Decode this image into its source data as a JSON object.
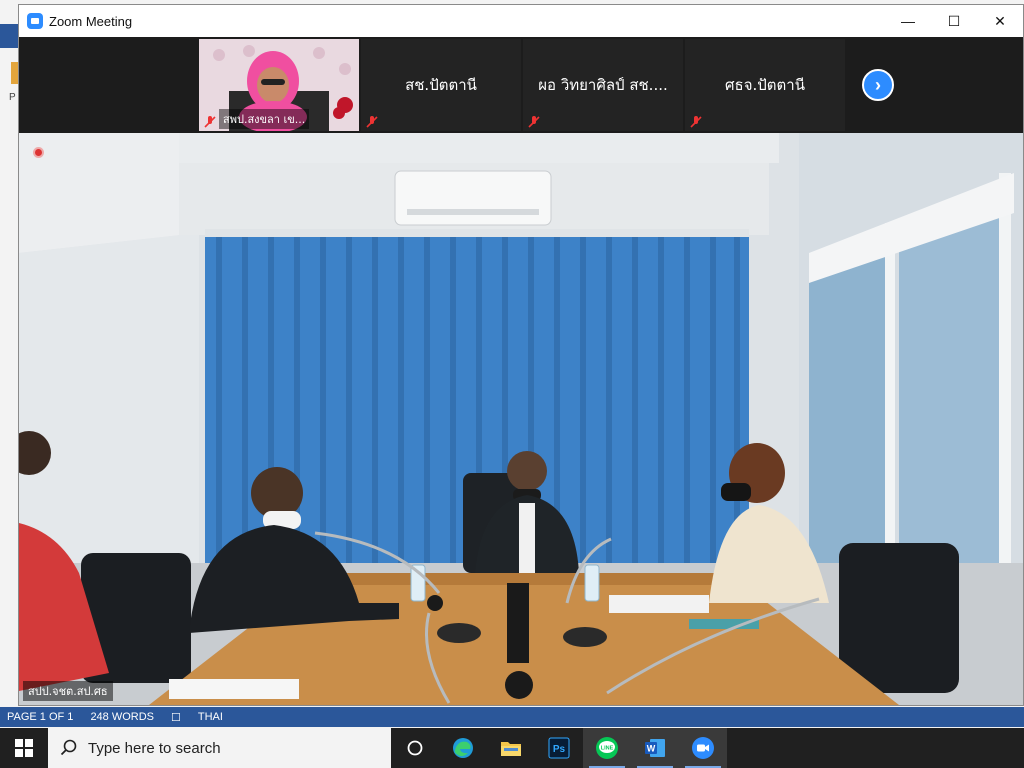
{
  "window": {
    "title": "Zoom Meeting"
  },
  "window_controls": {
    "minimize": "—",
    "maximize": "☐",
    "close": "✕"
  },
  "gallery": {
    "video_tile_name": "สพป.สงขลา เข...",
    "tiles": [
      {
        "name": "สช.ปัตตานี"
      },
      {
        "name": "ผอ วิทยาศิลป์ สช...."
      },
      {
        "name": "ศธจ.ปัตตานี"
      }
    ],
    "next_label": "›"
  },
  "main": {
    "speaker_name": "สปป.จชต.สป.ศธ"
  },
  "statusbar": {
    "page": "PAGE 1 OF 1",
    "words": "248 WORDS",
    "language": "THAI"
  },
  "background_app": {
    "side_label": "P"
  },
  "taskbar": {
    "search_placeholder": "Type here to search",
    "apps": [
      "task-view",
      "edge",
      "file-explorer",
      "photoshop",
      "line",
      "word",
      "zoom"
    ]
  },
  "colors": {
    "zoom_blue": "#2d8cff",
    "word_blue": "#2b579a",
    "line_green": "#06c755",
    "curtain_blue": "#3d82c8"
  }
}
